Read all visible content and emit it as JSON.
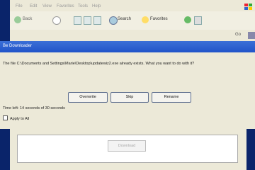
{
  "browser": {
    "menu": [
      "File",
      "Edit",
      "View",
      "Favorites",
      "Tools",
      "Help"
    ],
    "toolbar": {
      "back_label": "Back",
      "search_label": "Search",
      "favorites_label": "Favorites"
    },
    "go_label": "Go"
  },
  "dialog": {
    "title": "Be Downloader",
    "message": "The file C:\\Documents and Settings\\Marie\\Desktop\\updatewiz2.exe already exists. What you want to do with it?",
    "buttons": {
      "overwrite": "Overwrite",
      "skip": "Skip",
      "rename": "Rename"
    },
    "time_left": "Time left: 14 seconds of 30 seconds",
    "apply_all": "Apply to All"
  },
  "frame": {
    "download_label": "Download"
  },
  "colors": {
    "title_bar": "#2154c9",
    "desktop": "#0a246a",
    "window_bg": "#ece9d8"
  }
}
